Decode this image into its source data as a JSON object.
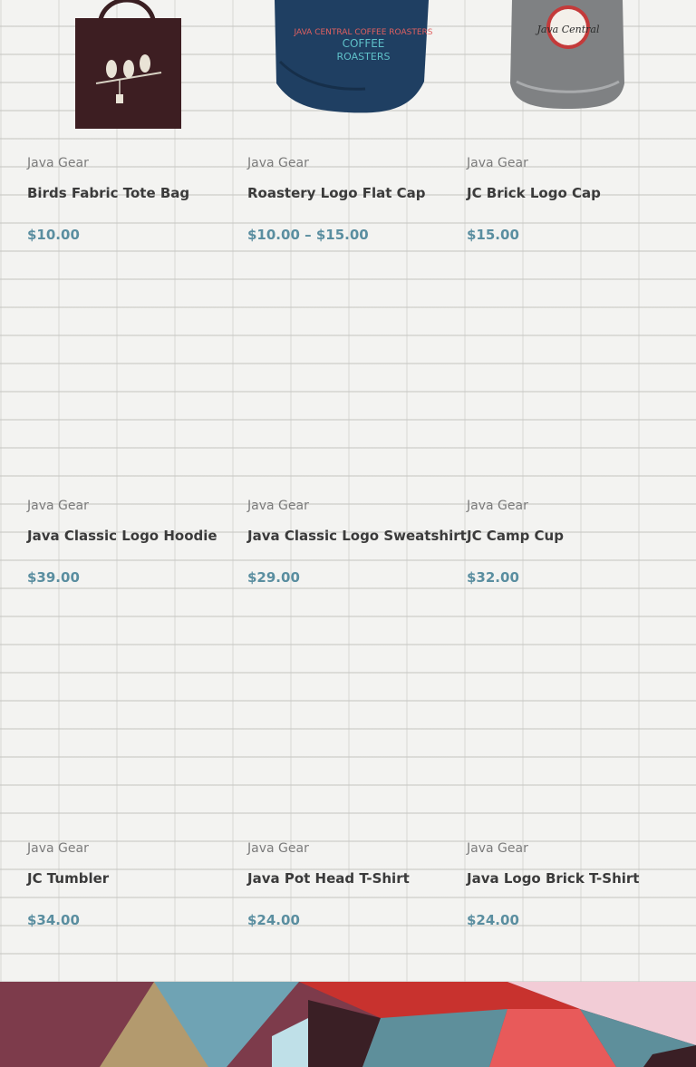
{
  "products": [
    {
      "category": "Java Gear",
      "title": "Birds Fabric Tote Bag",
      "price": "$10.00",
      "image": "tote-bag-birds"
    },
    {
      "category": "Java Gear",
      "title": "Roastery Logo Flat Cap",
      "price": "$10.00 – $15.00",
      "image": "flat-cap-navy",
      "image_text": "JAVA CENTRAL COFFEE ROASTERS"
    },
    {
      "category": "Java Gear",
      "title": "JC Brick Logo Cap",
      "price": "$15.00",
      "image": "gray-cap-logo",
      "image_text": "Java Central"
    },
    {
      "category": "Java Gear",
      "title": "Java Classic Logo Hoodie",
      "price": "$39.00"
    },
    {
      "category": "Java Gear",
      "title": "Java Classic Logo Sweatshirt",
      "price": "$29.00"
    },
    {
      "category": "Java Gear",
      "title": "JC Camp Cup",
      "price": "$32.00"
    },
    {
      "category": "Java Gear",
      "title": "JC Tumbler",
      "price": "$34.00"
    },
    {
      "category": "Java Gear",
      "title": "Java Pot Head T-Shirt",
      "price": "$24.00"
    },
    {
      "category": "Java Gear",
      "title": "Java Logo Brick T-Shirt",
      "price": "$24.00"
    }
  ],
  "colors": {
    "price": "#5a8ea0",
    "title": "#3b3b3b",
    "category": "#7b7b7b",
    "banner": [
      "#7d3b4b",
      "#b39a6e",
      "#6fa3b4",
      "#3a1f25",
      "#c8322e",
      "#f2ccd6",
      "#e85a5a",
      "#5e8f9b"
    ]
  }
}
